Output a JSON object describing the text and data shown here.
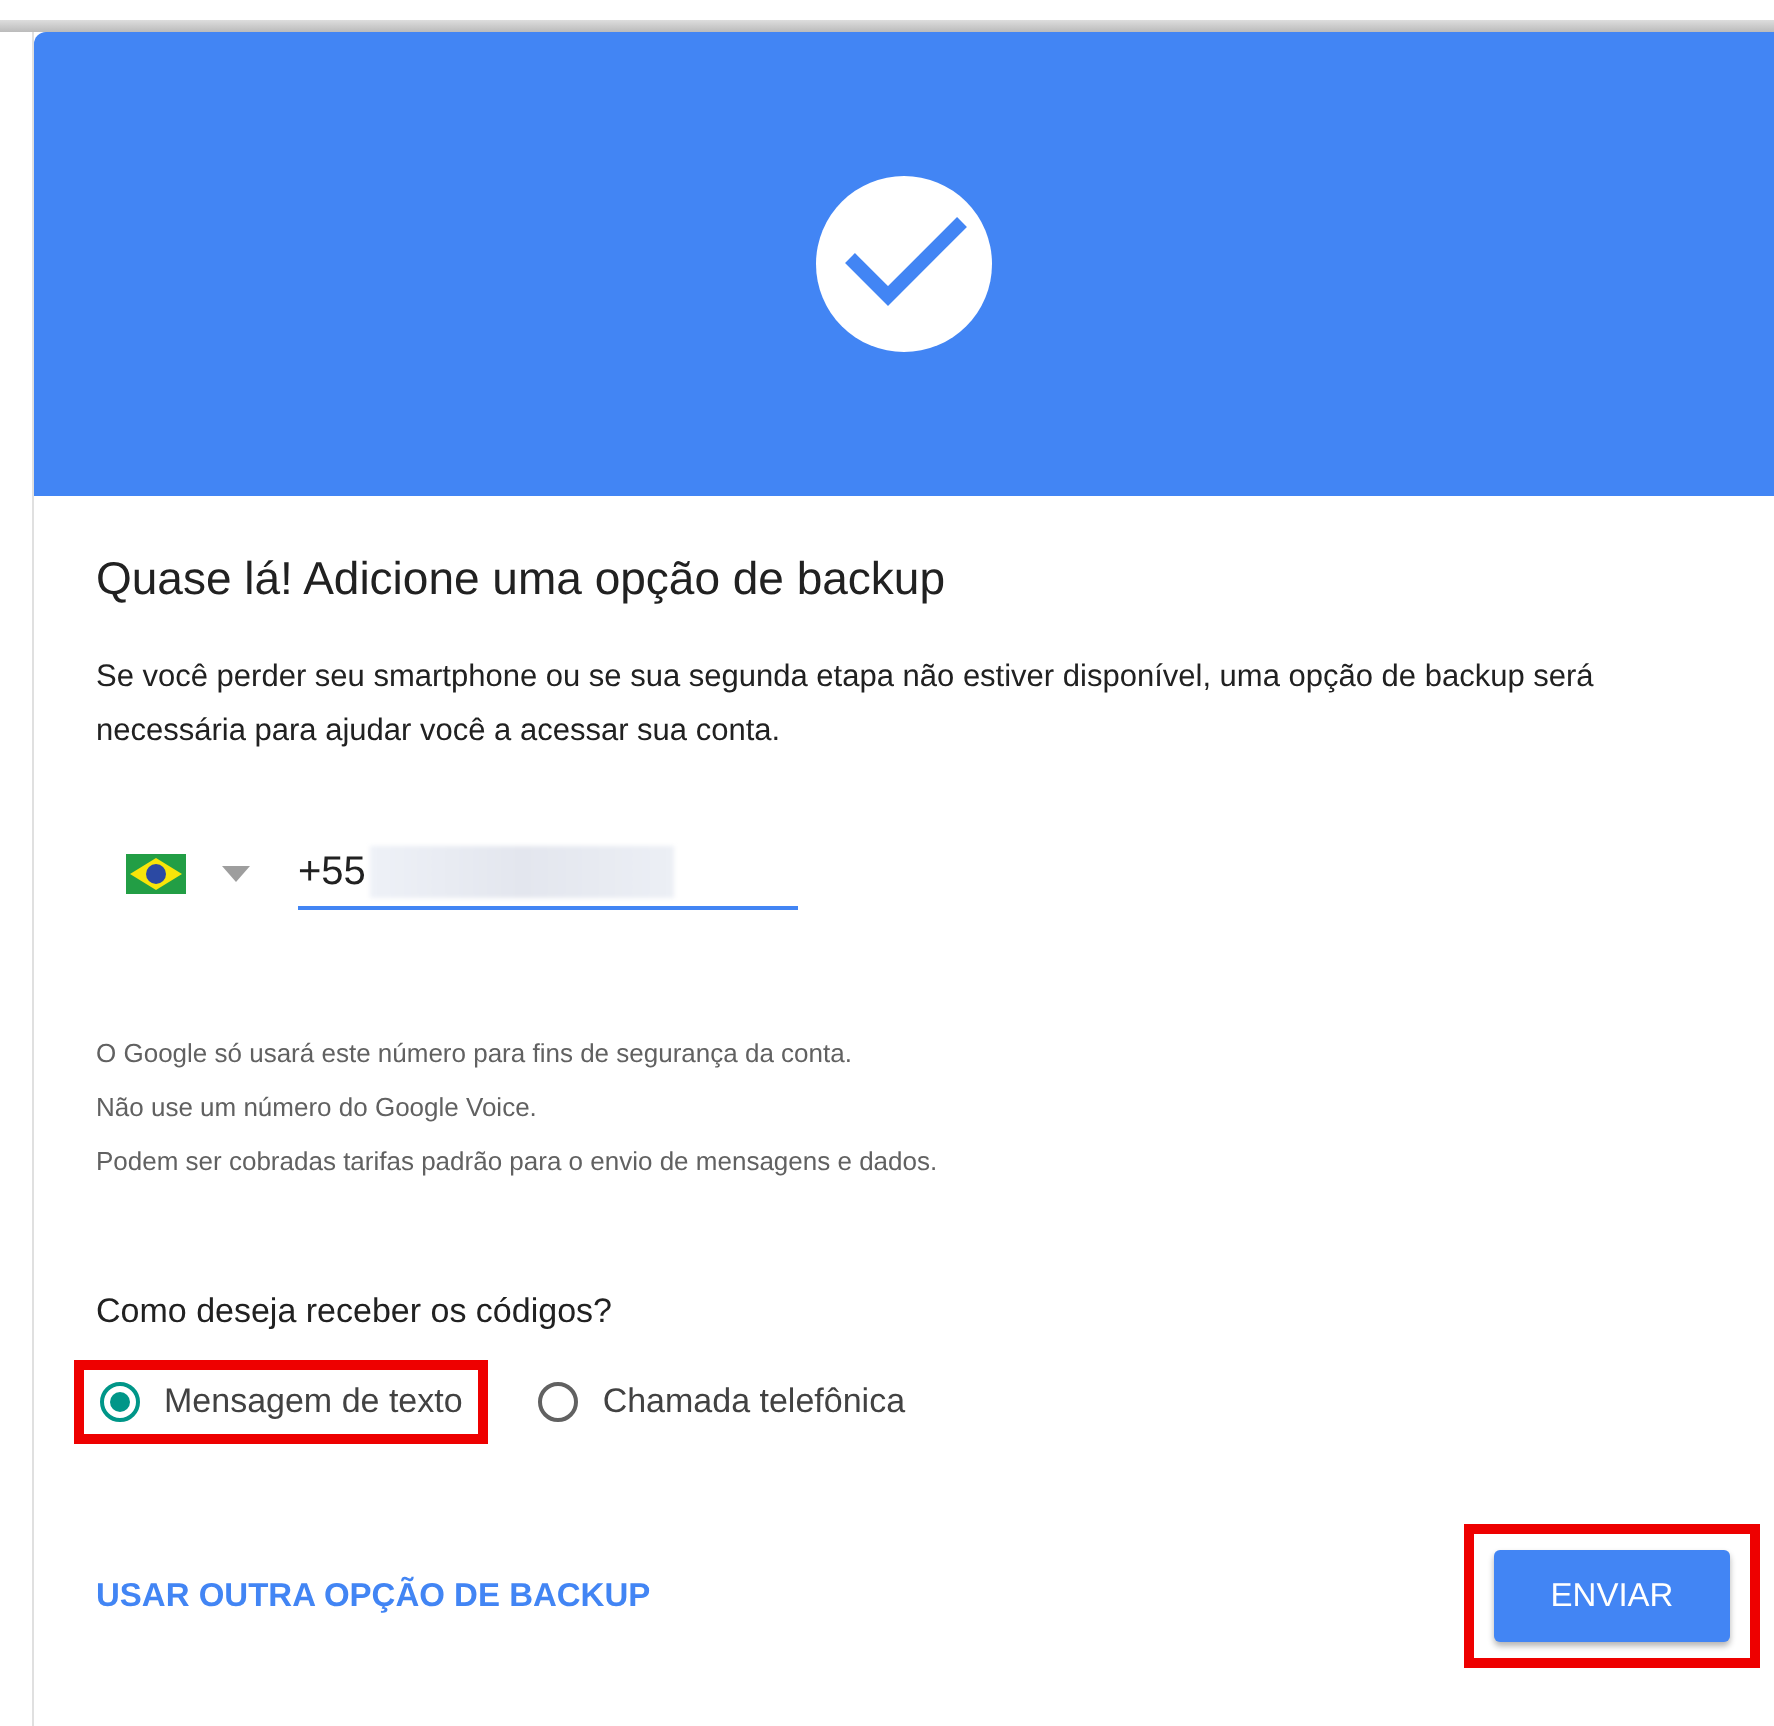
{
  "title": "Quase lá! Adicione uma opção de backup",
  "description": "Se você perder seu smartphone ou se sua segunda etapa não estiver disponível, uma opção de backup será necessária para ajudar você a acessar sua conta.",
  "phone": {
    "value": "+55",
    "redacted": true
  },
  "notes": [
    "O Google só usará este número para fins de segurança da conta.",
    "Não use um número do Google Voice.",
    "Podem ser cobradas tarifas padrão para o envio de mensagens e dados."
  ],
  "question": "Como deseja receber os códigos?",
  "options": [
    {
      "label": "Mensagem de texto",
      "selected": true,
      "highlighted": true
    },
    {
      "label": "Chamada telefônica",
      "selected": false,
      "highlighted": false
    }
  ],
  "link": "USAR OUTRA OPÇÃO DE BACKUP",
  "button": {
    "label": "ENVIAR",
    "highlighted": true
  }
}
